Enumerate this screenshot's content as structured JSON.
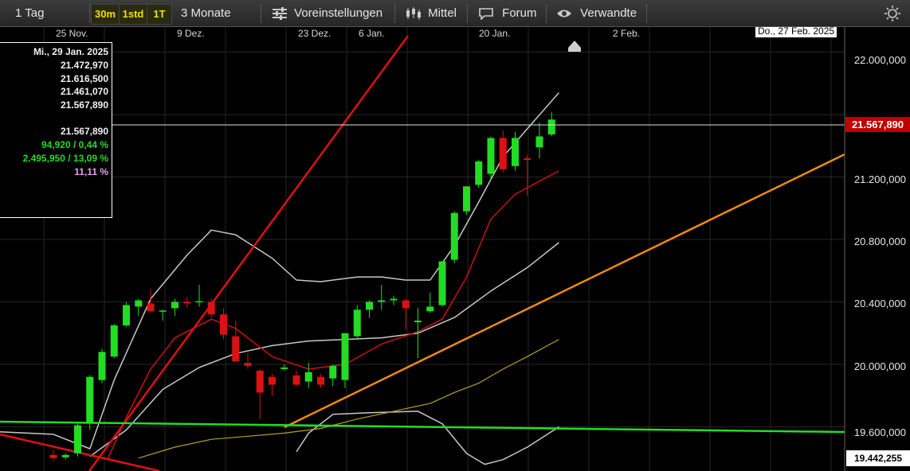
{
  "toolbar": {
    "period": "1 Tag",
    "btn_30m": "30m",
    "btn_1std": "1std",
    "btn_1t": "1T",
    "range": "3 Monate",
    "settings": "Voreinstellungen",
    "chart_type": "Mittel",
    "forum": "Forum",
    "related": "Verwandte",
    "settings_icon": "sliders-icon",
    "chart_icon": "candles-icon",
    "forum_icon": "chat-icon",
    "related_icon": "eye-icon",
    "theme_icon": "sun-icon"
  },
  "ohlc": {
    "date": "Mi., 29 Jan. 2025",
    "open": "21.472,970",
    "high": "21.616,500",
    "low": "21.461,070",
    "close": "21.567,890",
    "last": "21.567,890",
    "change": "94,920 / 0,44 %",
    "change_period": "2.495,950 / 13,09 %",
    "indicator": "11,11 %"
  },
  "crosshair_date": "Do., 27 Feb. 2025",
  "current_price": "21.567,890",
  "lowest_visible": "19.442,255",
  "colors": {
    "up": "#22dd22",
    "down": "#dd1111",
    "red_line": "#dd1111",
    "orange_line": "#ee8a10",
    "green_line": "#22dd22",
    "bollinger": "#c8c8c8",
    "ma_red": "#cc1111",
    "ma_yellow": "#b8a020"
  },
  "chart_data": {
    "type": "candlestick",
    "x_ticks": [
      "25 Nov.",
      "9 Dez.",
      "23 Dez.",
      "6 Jan.",
      "20 Jan.",
      "2 Feb."
    ],
    "y_ticks": [
      "22.000,000",
      "21.200,000",
      "20.800,000",
      "20.400,000",
      "20.000,000",
      "19.600,000"
    ],
    "ylim": [
      19400,
      22200
    ],
    "candles": [
      {
        "o": 19420,
        "h": 19450,
        "l": 19380,
        "c": 19400
      },
      {
        "o": 19405,
        "h": 19430,
        "l": 19390,
        "c": 19420
      },
      {
        "o": 19430,
        "h": 19620,
        "l": 19410,
        "c": 19610
      },
      {
        "o": 19620,
        "h": 19930,
        "l": 19580,
        "c": 19920
      },
      {
        "o": 19900,
        "h": 20100,
        "l": 19880,
        "c": 20080
      },
      {
        "o": 20050,
        "h": 20260,
        "l": 20040,
        "c": 20250
      },
      {
        "o": 20250,
        "h": 20400,
        "l": 20240,
        "c": 20380
      },
      {
        "o": 20370,
        "h": 20420,
        "l": 20310,
        "c": 20410
      },
      {
        "o": 20390,
        "h": 20480,
        "l": 20370,
        "c": 20340
      },
      {
        "o": 20340,
        "h": 20350,
        "l": 20280,
        "c": 20345
      },
      {
        "o": 20360,
        "h": 20420,
        "l": 20310,
        "c": 20400
      },
      {
        "o": 20400,
        "h": 20430,
        "l": 20360,
        "c": 20390
      },
      {
        "o": 20400,
        "h": 20510,
        "l": 20370,
        "c": 20405
      },
      {
        "o": 20400,
        "h": 20420,
        "l": 20300,
        "c": 20320
      },
      {
        "o": 20320,
        "h": 20360,
        "l": 20160,
        "c": 20190
      },
      {
        "o": 20180,
        "h": 20280,
        "l": 20070,
        "c": 20020
      },
      {
        "o": 20010,
        "h": 20070,
        "l": 19970,
        "c": 19990
      },
      {
        "o": 19960,
        "h": 19970,
        "l": 19650,
        "c": 19820
      },
      {
        "o": 19920,
        "h": 19940,
        "l": 19800,
        "c": 19870
      },
      {
        "o": 19970,
        "h": 20000,
        "l": 19960,
        "c": 19980
      },
      {
        "o": 19930,
        "h": 19960,
        "l": 19860,
        "c": 19870
      },
      {
        "o": 19890,
        "h": 20010,
        "l": 19850,
        "c": 19950
      },
      {
        "o": 19920,
        "h": 19940,
        "l": 19850,
        "c": 19870
      },
      {
        "o": 19910,
        "h": 20000,
        "l": 19860,
        "c": 19990
      },
      {
        "o": 19900,
        "h": 20200,
        "l": 19850,
        "c": 20200
      },
      {
        "o": 20180,
        "h": 20380,
        "l": 20170,
        "c": 20350
      },
      {
        "o": 20350,
        "h": 20410,
        "l": 20300,
        "c": 20400
      },
      {
        "o": 20400,
        "h": 20510,
        "l": 20350,
        "c": 20410
      },
      {
        "o": 20410,
        "h": 20440,
        "l": 20380,
        "c": 20420
      },
      {
        "o": 20410,
        "h": 20420,
        "l": 20220,
        "c": 20360
      },
      {
        "o": 20270,
        "h": 20360,
        "l": 20040,
        "c": 20280
      },
      {
        "o": 20340,
        "h": 20460,
        "l": 20330,
        "c": 20370
      },
      {
        "o": 20380,
        "h": 20660,
        "l": 20370,
        "c": 20660
      },
      {
        "o": 20670,
        "h": 20980,
        "l": 20650,
        "c": 20970
      },
      {
        "o": 20980,
        "h": 21140,
        "l": 20960,
        "c": 21140
      },
      {
        "o": 21150,
        "h": 21310,
        "l": 21130,
        "c": 21300
      },
      {
        "o": 21220,
        "h": 21460,
        "l": 21180,
        "c": 21450
      },
      {
        "o": 21450,
        "h": 21500,
        "l": 21230,
        "c": 21250
      },
      {
        "o": 21270,
        "h": 21490,
        "l": 21240,
        "c": 21450
      },
      {
        "o": 21320,
        "h": 21340,
        "l": 21080,
        "c": 21310
      },
      {
        "o": 21390,
        "h": 21550,
        "l": 21320,
        "c": 21460
      },
      {
        "o": 21473,
        "h": 21617,
        "l": 21461,
        "c": 21568
      }
    ]
  }
}
